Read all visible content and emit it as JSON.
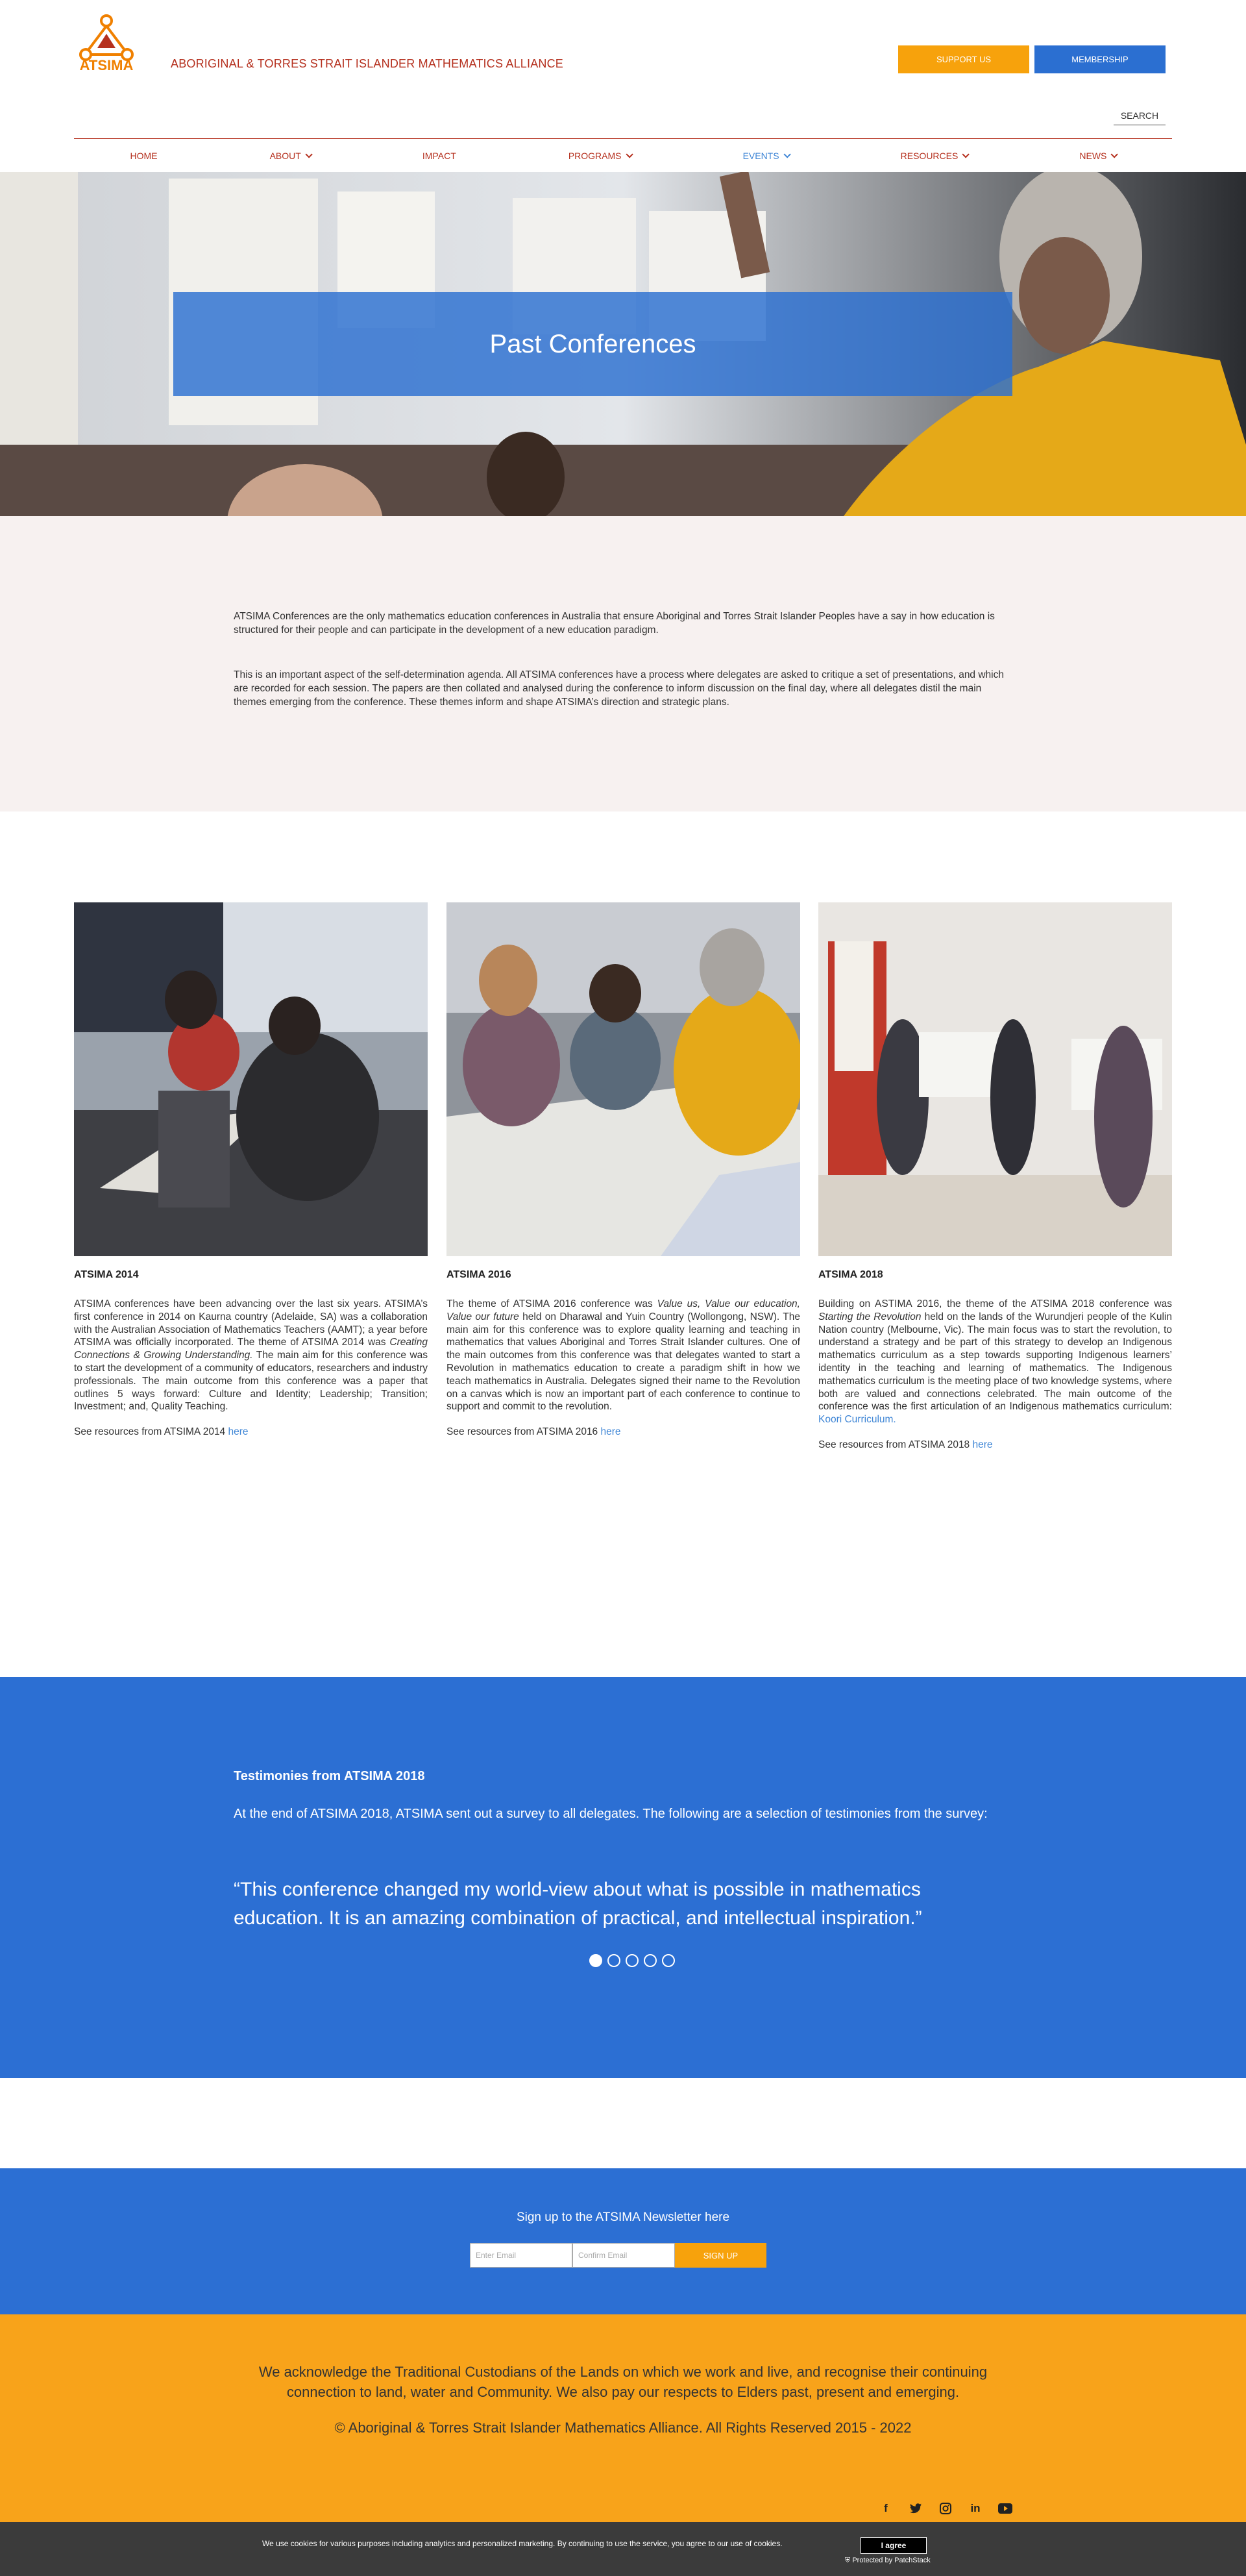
{
  "brand": {
    "logo_text": "ATSIMA",
    "org_name": "ABORIGINAL & TORRES STRAIT ISLANDER MATHEMATICS ALLIANCE",
    "accent_color": "#b5301e",
    "orange": "#f7a20c",
    "blue": "#2b6fd1"
  },
  "header": {
    "support_label": "SUPPORT US",
    "membership_label": "MEMBERSHIP",
    "search_label": "SEARCH"
  },
  "nav": {
    "items": [
      {
        "label": "HOME"
      },
      {
        "label": "ABOUT"
      },
      {
        "label": "IMPACT"
      },
      {
        "label": "PROGRAMS"
      },
      {
        "label": "EVENTS"
      },
      {
        "label": "RESOURCES"
      },
      {
        "label": "NEWS"
      }
    ]
  },
  "hero": {
    "title": "Past Conferences"
  },
  "intro": {
    "p1": "ATSIMA Conferences are the only mathematics education conferences in Australia that ensure Aboriginal and Torres Strait Islander Peoples have a say in how education is structured for their people and can participate in the development of a new education paradigm.",
    "p2": "This is an important aspect of the self-determination agenda. All ATSIMA conferences have a process where delegates are asked to critique a set of presentations, and which are recorded for each session. The papers are then collated and analysed during the conference to inform discussion on the final day, where all delegates distil the main themes emerging from the conference. These themes inform and shape ATSIMA’s direction and strategic plans."
  },
  "conferences": [
    {
      "title": "ATSIMA 2014",
      "body_a": "ATSIMA conferences have been advancing over the last six years. ATSIMA’s first conference in 2014 on Kaurna country (Adelaide, SA) was a collaboration with the Australian Association of Mathematics Teachers (AAMT); a year before ATSIMA was officially incorporated. The theme of ATSIMA 2014 was ",
      "body_em": "Creating Connections & Growing Understanding.",
      "body_b": " The main aim for this conference was to start the development of a community of educators, researchers and industry professionals. The main outcome from this conference was a paper that outlines 5 ways forward: Culture and Identity; Leadership; Transition; Investment; and, Quality Teaching.",
      "see": "See resources from ATSIMA 2014 ",
      "link": "here"
    },
    {
      "title": "ATSIMA 2016",
      "body_a": "The theme of ATSIMA 2016 conference was ",
      "body_em": "Value us, Value our education, Value our future",
      "body_b": " held on Dharawal and Yuin Country (Wollongong, NSW). The main aim for this conference was to explore quality learning and teaching in mathematics that values Aboriginal and Torres Strait Islander cultures. One of the main outcomes from this conference was that delegates wanted to start a Revolution in mathematics education to create a paradigm shift in how we teach mathematics in Australia. Delegates signed their name to the Revolution on a canvas which is now an important part of each conference to continue to support and commit to the revolution.",
      "see": "See resources from ATSIMA 2016 ",
      "link": "here"
    },
    {
      "title": "ATSIMA 2018",
      "body_a": "Building on ASTIMA 2016, the theme of the ATSIMA 2018 conference was ",
      "body_em": "Starting the Revolution",
      "body_b": " held on the lands of the Wurundjeri people of the Kulin Nation country (Melbourne, Vic). The main focus was to start the revolution, to understand a strategy and be part of this strategy to develop an Indigenous mathematics curriculum as a step towards supporting Indigenous learners’ identity in the teaching and learning of mathematics. The Indigenous mathematics curriculum is the meeting place of two knowledge systems, where both are valued and connections celebrated. The main outcome of the conference was the first articulation of an Indigenous mathematics curriculum: ",
      "body_link": "Koori Curriculum.",
      "see": "See resources from ATSIMA 2018 ",
      "link": "here"
    }
  ],
  "testimonies": {
    "title": "Testimonies from ATSIMA 2018",
    "intro": "At the end of ATSIMA 2018, ATSIMA sent out a survey to all delegates. The following are a selection of testimonies from the survey:",
    "quote": "“This conference changed my world-view about what is possible in mathematics education. It is an amazing combination of practical, and intellectual inspiration.”"
  },
  "newsletter": {
    "title": "Sign up to the ATSIMA Newsletter here",
    "email_placeholder": "Enter Email",
    "confirm_placeholder": "Confirm Email",
    "button": "SIGN UP"
  },
  "footer": {
    "acknowledgement": "We acknowledge the Traditional Custodians of the Lands on which we work and live, and recognise their continuing connection to land, water and Community. We also pay our respects to Elders past, present and emerging.",
    "copyright": "© Aboriginal & Torres Strait Islander Mathematics Alliance. All Rights Reserved 2015 - 2022",
    "social_icons": [
      "facebook-icon",
      "twitter-icon",
      "instagram-icon",
      "linkedin-icon",
      "youtube-icon"
    ]
  },
  "cookie": {
    "text": "We use cookies for various purposes including analytics and personalized marketing. By continuing to use the service, you agree to our use of cookies.",
    "button": "I agree",
    "protected": "Protected by PatchStack"
  }
}
